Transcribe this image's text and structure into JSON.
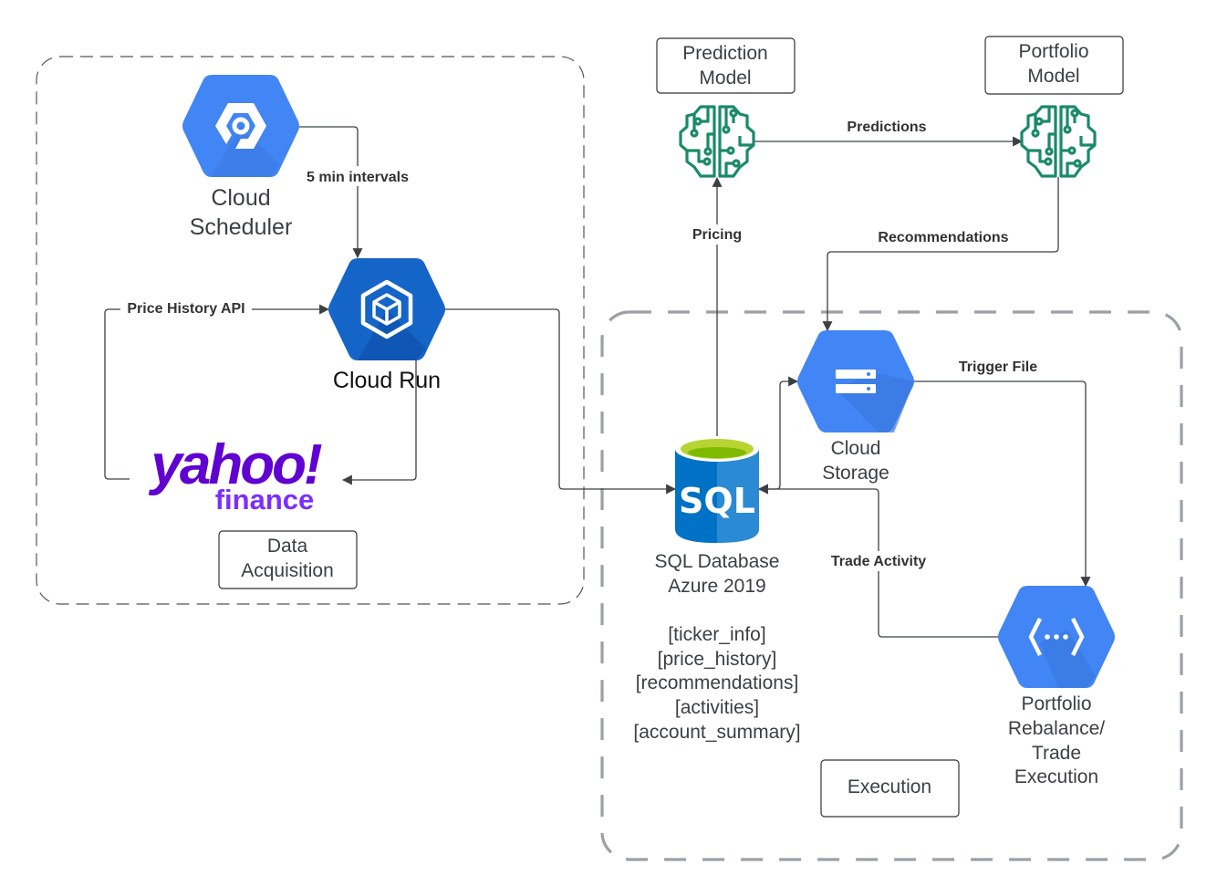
{
  "groups": {
    "data_acquisition": "Data Acquisition",
    "execution": "Execution"
  },
  "nodes": {
    "cloud_scheduler": [
      "Cloud",
      "Scheduler"
    ],
    "cloud_run": "Cloud Run",
    "yahoo": {
      "logo_text": "yahoo!",
      "logo_sub": "finance"
    },
    "prediction_model": [
      "Prediction",
      "Model"
    ],
    "portfolio_model": [
      "Portfolio",
      "Model"
    ],
    "sql_database": {
      "icon_text": "SQL",
      "label": [
        "SQL Database",
        "Azure 2019"
      ],
      "tables": [
        "[ticker_info]",
        "[price_history]",
        "[recommendations]",
        "[activities]",
        "[account_summary]"
      ]
    },
    "cloud_storage": [
      "Cloud",
      "Storage"
    ],
    "portfolio_rebalance": [
      "Portfolio",
      "Rebalance/",
      "Trade",
      "Execution"
    ]
  },
  "edges": {
    "scheduler_to_run": "5 min intervals",
    "yahoo_to_run": "Price History API",
    "sql_to_prediction": "Pricing",
    "prediction_to_portfolio": "Predictions",
    "portfolio_to_storage": "Recommendations",
    "storage_to_rebalance": "Trigger File",
    "rebalance_to_sql": "Trade Activity"
  },
  "colors": {
    "gcp_blue": "#4285f4",
    "cloud_run_blue": "#1565c8",
    "brain_green": "#1a8a6a",
    "yahoo_purple": "#6001d2",
    "sql_blue": "#0072c6",
    "sql_top": "#b8d432"
  }
}
